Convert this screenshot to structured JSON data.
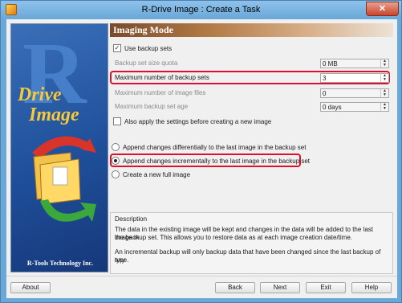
{
  "window": {
    "title": "R-Drive Image : Create a Task",
    "close_glyph": "✕",
    "icon": "app-icon"
  },
  "side_panel": {
    "logo_letter": "R",
    "logo_word1": "Drive",
    "logo_word2": "Image",
    "footer": "R-Tools Technology Inc."
  },
  "section": {
    "title": "Imaging Mode"
  },
  "options": {
    "use_backup_sets": {
      "label": "Use backup sets",
      "checked": true,
      "mark": "✓"
    },
    "backup_set_size_quota": {
      "label": "Backup set size quota",
      "value": "0 MB",
      "enabled": false
    },
    "max_backup_sets": {
      "label": "Maximum number of backup sets",
      "value": "3",
      "enabled": true
    },
    "max_image_files": {
      "label": "Maximum number of image files",
      "value": "0",
      "enabled": false
    },
    "max_backup_set_age": {
      "label": "Maximum backup set age",
      "value": "0 days",
      "enabled": false
    },
    "apply_before_new": {
      "label": "Also apply the settings before creating a new image",
      "checked": false
    }
  },
  "mode": {
    "differential": "Append changes differentially to the last image in the backup set",
    "incremental": "Append changes incrementally to the last image in the backup set",
    "new_full": "Create a new full image",
    "selected": "incremental"
  },
  "description": {
    "title": "Description",
    "line1": "The data in the existing image will be kept and changes in the data will be added to the last image in",
    "line2": "the backup set. This allows you to restore data as at each image creation date/time.",
    "line3": "An incremental backup will only backup data that have been changed since the last backup of any",
    "line4": "type."
  },
  "buttons": {
    "about": "About",
    "back": "Back",
    "next": "Next",
    "exit": "Exit",
    "help": "Help"
  },
  "colors": {
    "highlight": "#e0102a",
    "header_start": "#7a4a2a",
    "logo": "#f5c93a"
  }
}
